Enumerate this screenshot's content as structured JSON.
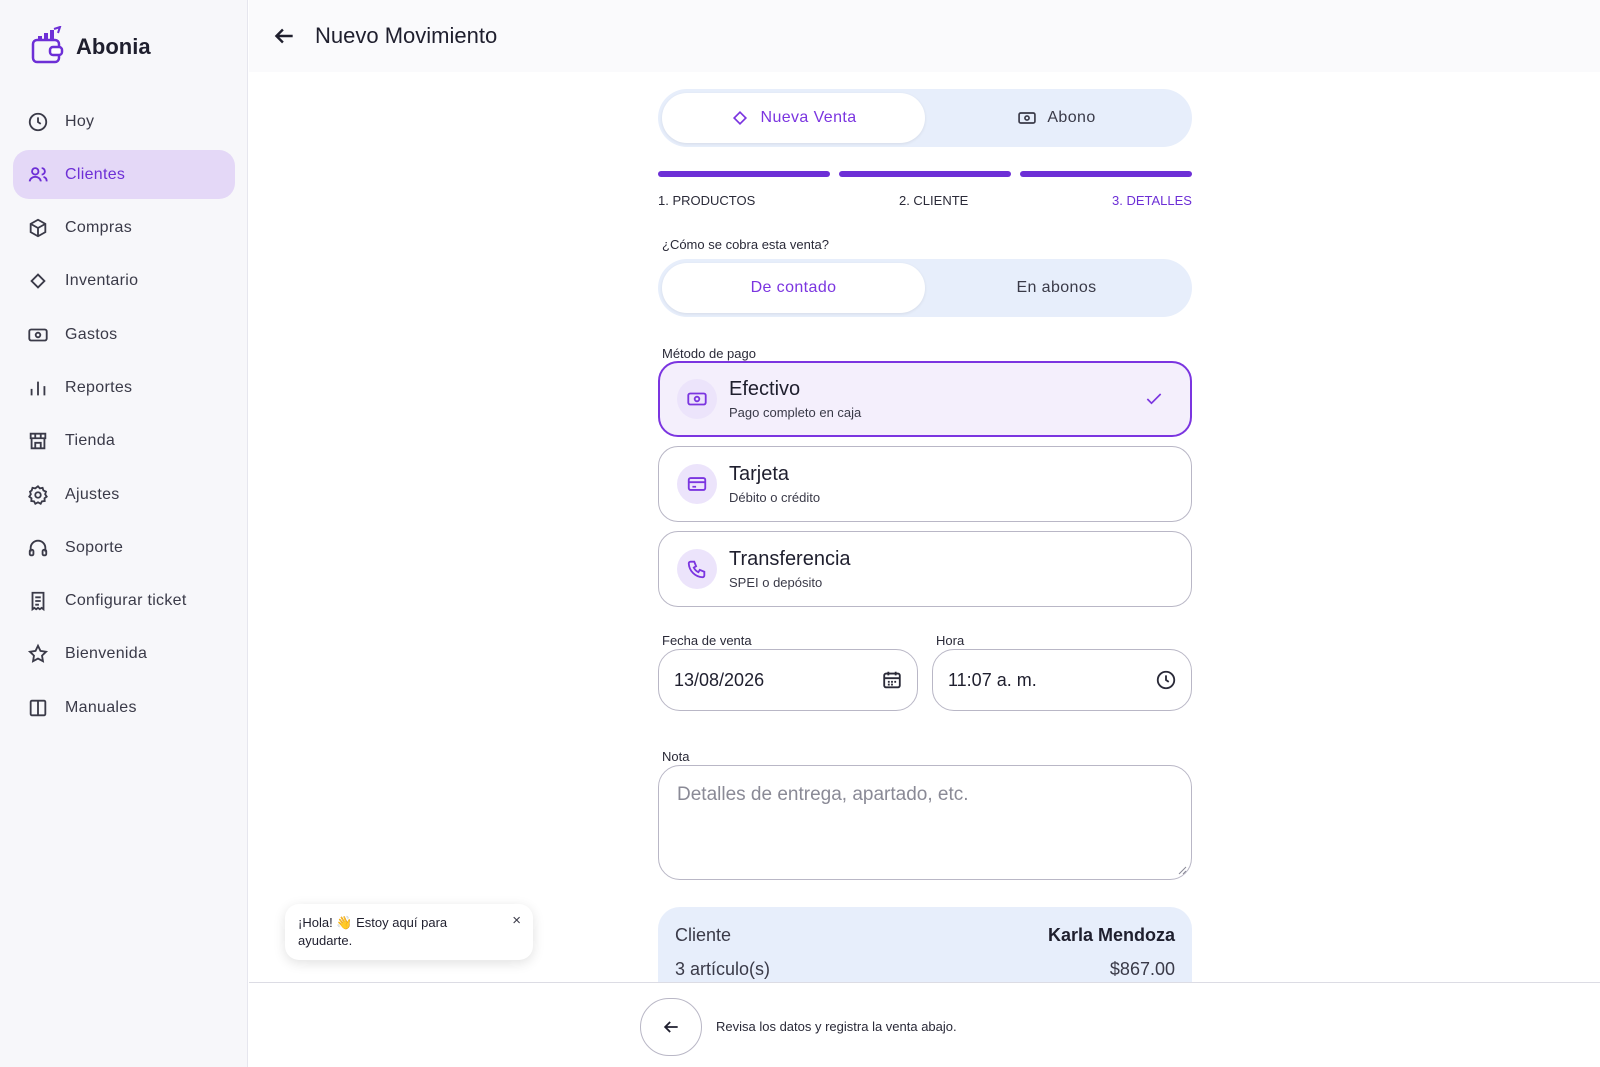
{
  "brand": {
    "name": "Abonia",
    "accent": "#6d2fd6"
  },
  "sidebar": {
    "items": [
      {
        "label": "Hoy",
        "icon": "clock-icon"
      },
      {
        "label": "Clientes",
        "icon": "users-icon",
        "active": true
      },
      {
        "label": "Compras",
        "icon": "box-icon"
      },
      {
        "label": "Inventario",
        "icon": "diamond-icon"
      },
      {
        "label": "Gastos",
        "icon": "banknote-icon"
      },
      {
        "label": "Reportes",
        "icon": "bar-chart-icon"
      },
      {
        "label": "Tienda",
        "icon": "store-icon"
      },
      {
        "label": "Ajustes",
        "icon": "gear-icon"
      },
      {
        "label": "Soporte",
        "icon": "headphones-icon"
      },
      {
        "label": "Configurar ticket",
        "icon": "receipt-icon"
      },
      {
        "label": "Bienvenida",
        "icon": "star-icon"
      },
      {
        "label": "Manuales",
        "icon": "book-icon"
      }
    ]
  },
  "header": {
    "title": "Nuevo Movimiento"
  },
  "mode": {
    "sale": "Nueva Venta",
    "payment": "Abono",
    "selected": "sale"
  },
  "steps": {
    "s1": "1. PRODUCTOS",
    "s2": "2. CLIENTE",
    "s3": "3. DETALLES",
    "current": 3,
    "total": 3
  },
  "charge": {
    "question": "¿Cómo se cobra esta venta?",
    "cash": "De contado",
    "installments": "En abonos",
    "selected": "cash"
  },
  "payment_method": {
    "label": "Método de pago",
    "options": [
      {
        "title": "Efectivo",
        "subtitle": "Pago completo en caja",
        "icon": "banknote-icon",
        "selected": true
      },
      {
        "title": "Tarjeta",
        "subtitle": "Débito o crédito",
        "icon": "credit-card-icon",
        "selected": false
      },
      {
        "title": "Transferencia",
        "subtitle": "SPEI o depósito",
        "icon": "phone-icon",
        "selected": false
      }
    ]
  },
  "date_field": {
    "label": "Fecha de venta",
    "value": "13/08/2026"
  },
  "time_field": {
    "label": "Hora",
    "value": "11:07 a. m."
  },
  "note": {
    "label": "Nota",
    "placeholder": "Detalles de entrega, apartado, etc."
  },
  "summary": {
    "client_label": "Cliente",
    "client_name": "Karla Mendoza",
    "items_label": "3 artículo(s)",
    "total": "$867.00"
  },
  "toast": {
    "text": "¡Hola! 👋 Estoy aquí para ayudarte.",
    "close": "×"
  },
  "bottom": {
    "hint": "Revisa los datos y registra la venta abajo."
  }
}
